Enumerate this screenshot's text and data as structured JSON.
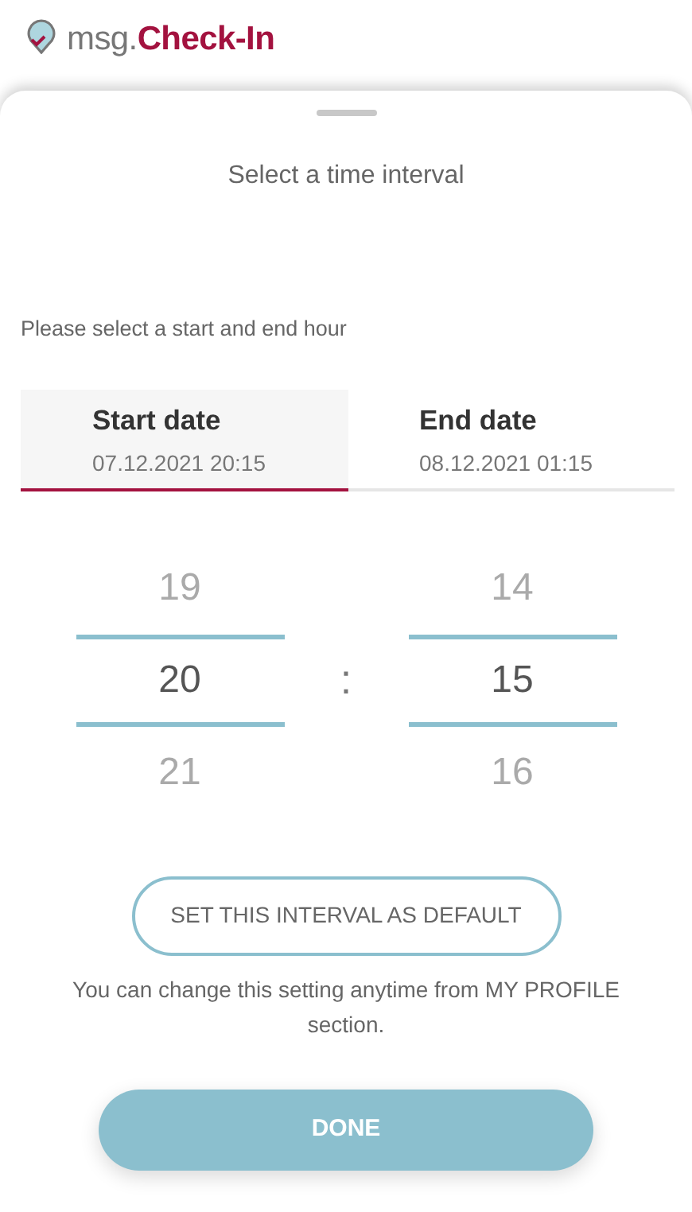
{
  "logo": {
    "text": "msg.**Check-In**"
  },
  "sheet": {
    "title": "Select a time interval",
    "instruction": "Please select a start and end hour"
  },
  "tabs": [
    {
      "label": "Start date",
      "value": "07.12.2021 20:15",
      "selected": true
    },
    {
      "label": "End date",
      "value": "08.12.2021 01:15",
      "selected": false
    }
  ],
  "picker": {
    "separator": ":",
    "columns": [
      {
        "items": [
          {
            "text": "19",
            "selected": false
          },
          {
            "text": "20",
            "selected": true
          },
          {
            "text": "21",
            "selected": false
          }
        ]
      },
      {
        "items": [
          {
            "text": "14",
            "selected": false
          },
          {
            "text": "15",
            "selected": true
          },
          {
            "text": "16",
            "selected": false
          }
        ]
      }
    ]
  },
  "default_button": "SET THIS INTERVAL AS DEFAULT",
  "note": "You can change this setting anytime from MY PROFILE section.",
  "done_button": "DONE"
}
